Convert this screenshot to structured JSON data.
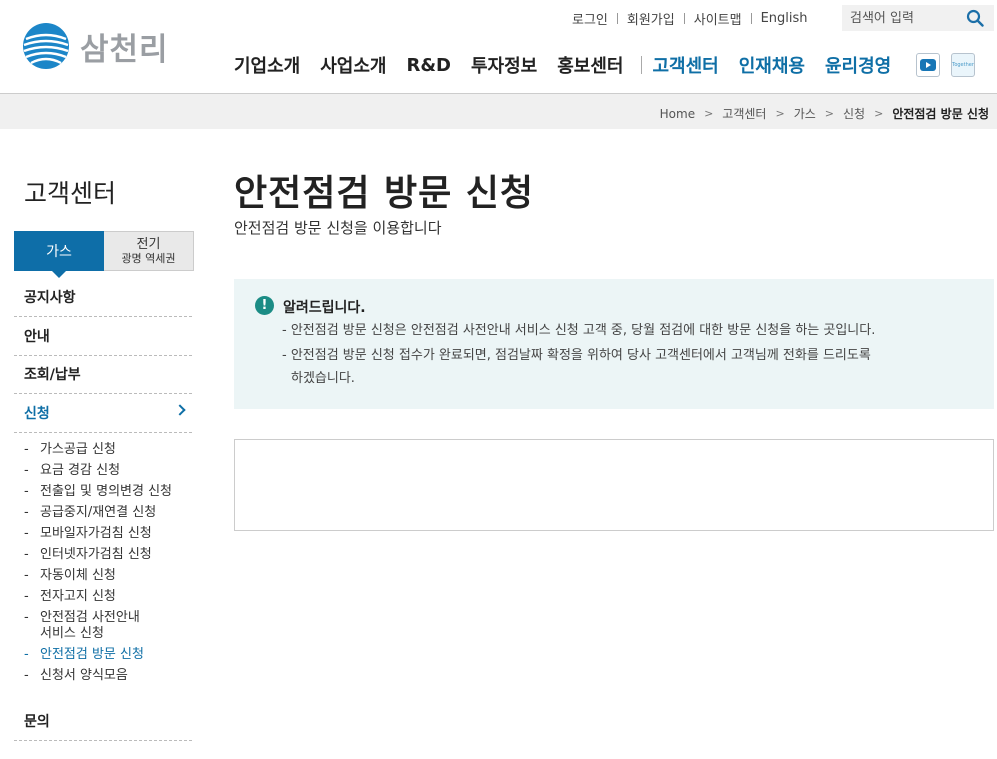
{
  "header": {
    "logo_text": "삼천리",
    "util_links": [
      "로그인",
      "회원가입",
      "사이트맵",
      "English"
    ],
    "search_placeholder": "검색어 입력",
    "gnb": [
      {
        "label": "기업소개",
        "color": "#222222"
      },
      {
        "label": "사업소개",
        "color": "#222222"
      },
      {
        "label": "R&D",
        "color": "#222222"
      },
      {
        "label": "투자정보",
        "color": "#222222"
      },
      {
        "label": "홍보센터",
        "color": "#222222"
      },
      {
        "label": "고객센터",
        "color": "#0f6fa6"
      },
      {
        "label": "인재채용",
        "color": "#0f6fa6"
      },
      {
        "label": "윤리경영",
        "color": "#0f6fa6"
      }
    ],
    "sns_icons": [
      "youtube-icon",
      "blog-icon"
    ],
    "blog_icon_text": "Together"
  },
  "breadcrumb": [
    "Home",
    "고객센터",
    "가스",
    "신청",
    "안전점검 방문 신청"
  ],
  "sidebar": {
    "title": "고객센터",
    "tabs": {
      "active": "가스",
      "other_line1": "전기",
      "other_line2": "광명 역세권"
    },
    "menu": [
      "공지사항",
      "안내",
      "조회/납부",
      "신청"
    ],
    "submenu": [
      "가스공급 신청",
      "요금 경감 신청",
      "전출입 및 명의변경 신청",
      "공급중지/재연결 신청",
      "모바일자가검침 신청",
      "인터넷자가검침 신청",
      "자동이체 신청",
      "전자고지 신청",
      "안전점검 사전안내",
      "서비스 신청",
      "안전점검 방문 신청",
      "신청서 양식모음"
    ],
    "last_menu": "문의"
  },
  "main": {
    "title": "안전점검 방문 신청",
    "subtitle": "안전점검 방문 신청을 이용합니다",
    "notice": {
      "title": "알려드립니다.",
      "lines": [
        "- 안전점검 방문 신청은 안전점검 사전안내 서비스 신청 고객 중, 당월 점검에 대한 방문 신청을 하는 곳입니다.",
        "- 안전점검 방문 신청 접수가 완료되면, 점검날짜 확정을 위하여 당사 고객센터에서 고객님께 전화를 드리도록",
        "하겠습니다."
      ]
    }
  },
  "colors": {
    "brand_blue": "#0e6ea8",
    "notice_bg": "#ecf5f6",
    "notice_icon": "#1b8c85"
  }
}
